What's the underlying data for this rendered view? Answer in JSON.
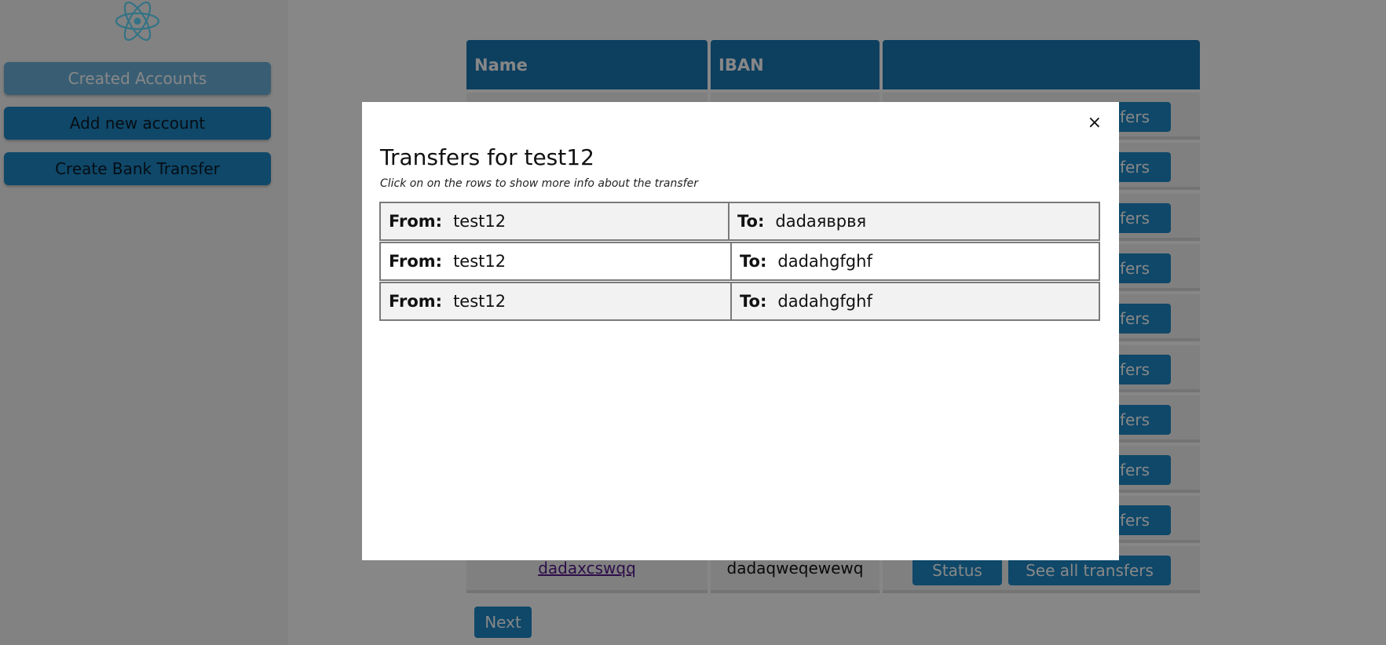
{
  "sidebar": {
    "logo": "react-atom-icon",
    "items": [
      {
        "label": "Created Accounts",
        "active": true
      },
      {
        "label": "Add new account",
        "active": false
      },
      {
        "label": "Create Bank Transfer",
        "active": false
      }
    ]
  },
  "table": {
    "headers": [
      "Name",
      "IBAN",
      ""
    ],
    "visible_row": {
      "name": "dadaxcswqq",
      "iban": "dadaqweqewewq"
    },
    "status_label": "Status",
    "transfers_label": "See all transfers",
    "partial_label": "sfers"
  },
  "pagination": {
    "next_label": "Next"
  },
  "modal": {
    "title": "Transfers for test12",
    "subtitle": "Click on on the rows to show more info about the transfer",
    "close_symbol": "×",
    "from_label": "From:",
    "to_label": "To:",
    "rows": [
      {
        "from": "test12",
        "to": "dadaяврвя"
      },
      {
        "from": "test12",
        "to": "dadahgfghf"
      },
      {
        "from": "test12",
        "to": "dadahgfghf"
      }
    ]
  },
  "colors": {
    "primary": "#1e88c7",
    "header": "#1a77b3",
    "overlay": "rgba(0,0,0,0.47)"
  }
}
